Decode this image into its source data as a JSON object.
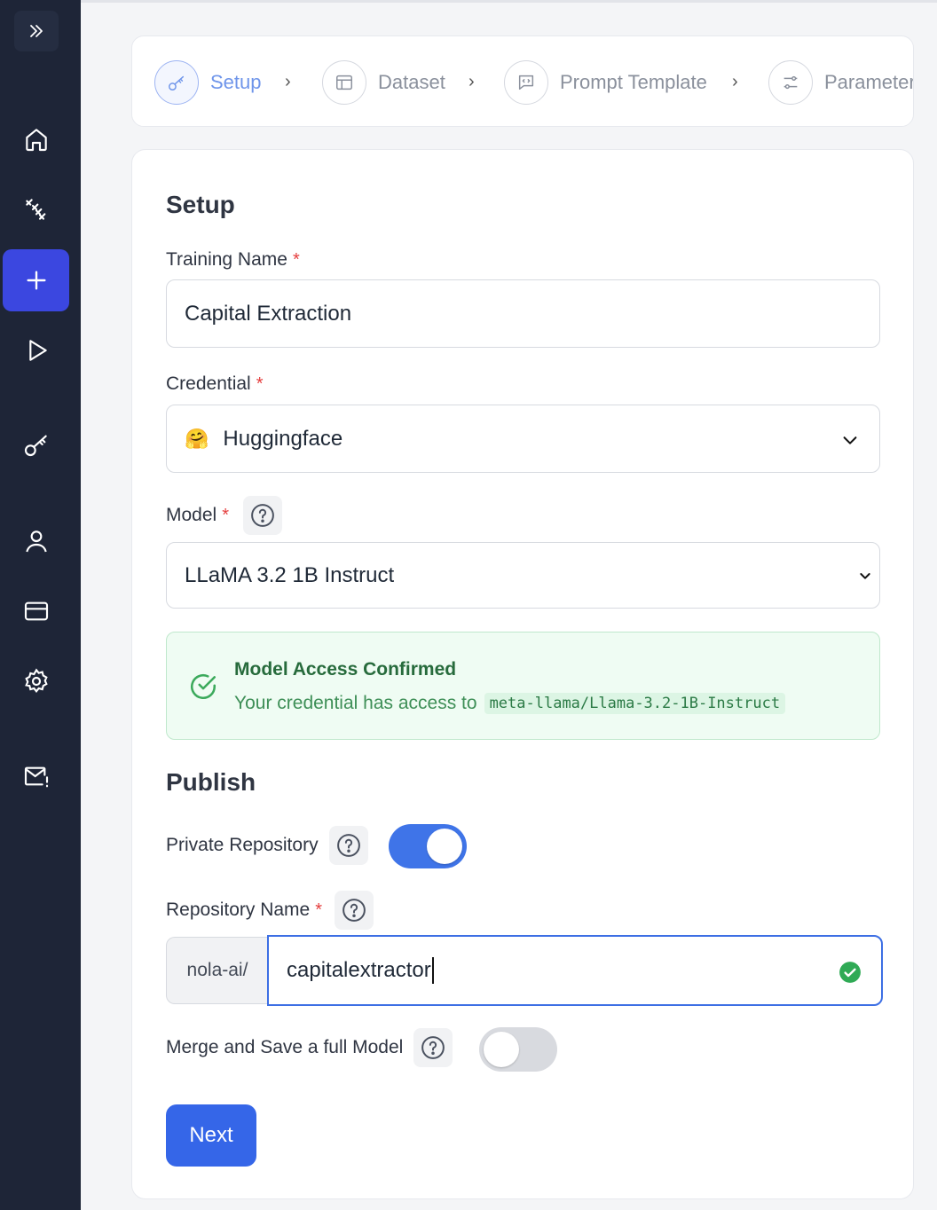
{
  "sidebar": {
    "icons": [
      "expand-icon",
      "home-icon",
      "models-icon",
      "plus-icon",
      "play-icon",
      "key-icon",
      "user-icon",
      "billing-icon",
      "settings-icon",
      "mail-icon"
    ]
  },
  "stepper": {
    "steps": [
      {
        "label": "Setup",
        "icon": "key-icon",
        "active": true
      },
      {
        "label": "Dataset",
        "icon": "table-icon",
        "active": false
      },
      {
        "label": "Prompt Template",
        "icon": "message-icon",
        "active": false
      },
      {
        "label": "Parameters",
        "icon": "sliders-icon",
        "active": false
      }
    ]
  },
  "setup": {
    "title": "Setup",
    "training_name_label": "Training Name",
    "training_name_value": "Capital Extraction",
    "credential_label": "Credential",
    "credential_emoji": "🤗",
    "credential_value": "Huggingface",
    "model_label": "Model",
    "model_value": "LLaMA 3.2 1B Instruct",
    "required_mark": "*"
  },
  "access": {
    "title": "Model Access Confirmed",
    "text": "Your credential has access to",
    "model_id": "meta-llama/Llama-3.2-1B-Instruct"
  },
  "publish": {
    "title": "Publish",
    "private_repo_label": "Private Repository",
    "private_repo_enabled": true,
    "repo_name_label": "Repository Name",
    "repo_prefix": "nola-ai/",
    "repo_name_value": "capitalextractor",
    "merge_label": "Merge and Save a full Model",
    "merge_enabled": false
  },
  "actions": {
    "next_label": "Next"
  },
  "colors": {
    "sidebar_bg": "#1e2537",
    "accent": "#3566e8",
    "success": "#276b3c",
    "required": "#e53e3e"
  }
}
